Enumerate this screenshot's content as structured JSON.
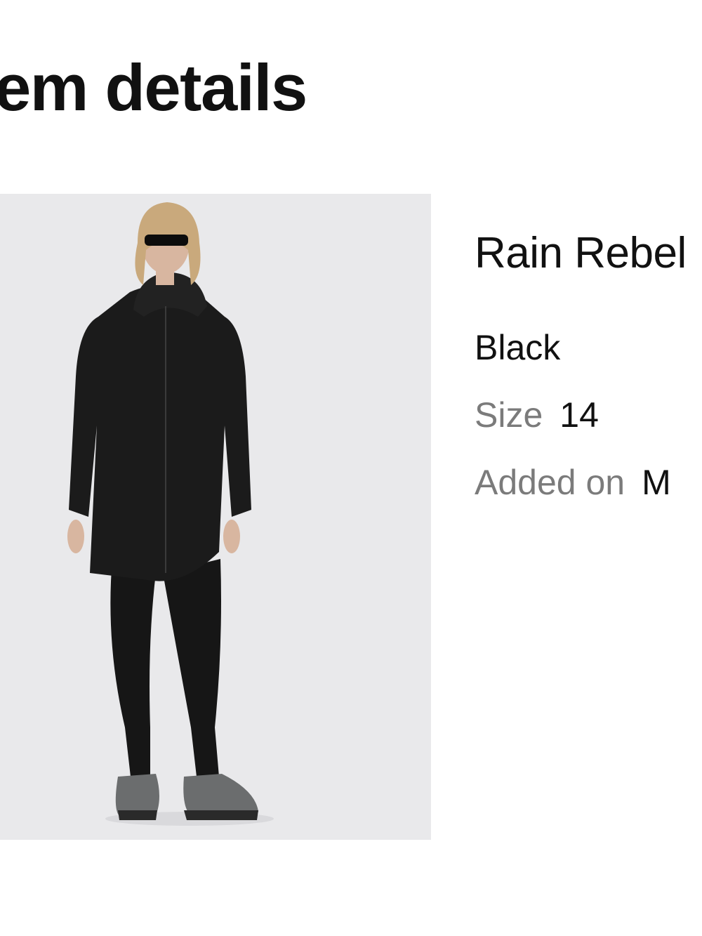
{
  "page": {
    "title": "em details"
  },
  "item": {
    "image_alt": "Woman wearing a long black hooded rain jacket with black leggings and grey trail shoes",
    "name": "Rain Rebel",
    "color": "Black",
    "size_label": "Size",
    "size_value": "14",
    "added_label": "Added on",
    "added_value": "M"
  },
  "colors": {
    "image_bg": "#e9e9eb",
    "label_grey": "#7b7b7b",
    "text": "#111111"
  }
}
